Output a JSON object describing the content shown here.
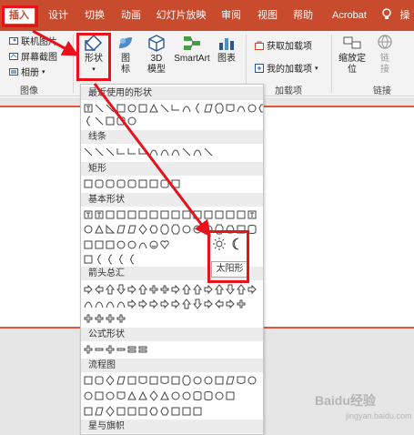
{
  "tabs": [
    {
      "label": "插入",
      "active": true
    },
    {
      "label": "设计"
    },
    {
      "label": "切换"
    },
    {
      "label": "动画"
    },
    {
      "label": "幻灯片放映"
    },
    {
      "label": "审阅"
    },
    {
      "label": "视图"
    },
    {
      "label": "帮助"
    },
    {
      "label": "Acrobat"
    },
    {
      "label": "操"
    }
  ],
  "ribbon": {
    "images_group": {
      "online_pictures": "联机图片",
      "screenshot": "屏幕截图",
      "album": "相册",
      "label": "图像"
    },
    "illustrations": {
      "shapes": "形状",
      "icons_line1": "图",
      "icons_line2": "标",
      "model_line1": "3D",
      "model_line2": "模型",
      "smartart": "SmartArt",
      "chart": "图表"
    },
    "addins": {
      "get_addins": "获取加载项",
      "my_addins": "我的加载项",
      "label": "加载项"
    },
    "links": {
      "zoom_line1": "缩放定",
      "zoom_line2": "位",
      "link_line1": "链",
      "link_line2": "接",
      "label": "链接"
    }
  },
  "shapes_panel": {
    "sections": [
      {
        "title": "最近使用的形状"
      },
      {
        "title": "线条"
      },
      {
        "title": "矩形"
      },
      {
        "title": "基本形状"
      },
      {
        "title": "箭头总汇"
      },
      {
        "title": "公式形状"
      },
      {
        "title": "流程图"
      },
      {
        "title": "星与旗帜"
      }
    ],
    "tooltip": "太阳形"
  },
  "watermark": {
    "main": "Baidu经验",
    "sub": "jingyan.baidu.com"
  },
  "colors": {
    "accent": "#c84b2e",
    "highlight": "#e8121a"
  }
}
